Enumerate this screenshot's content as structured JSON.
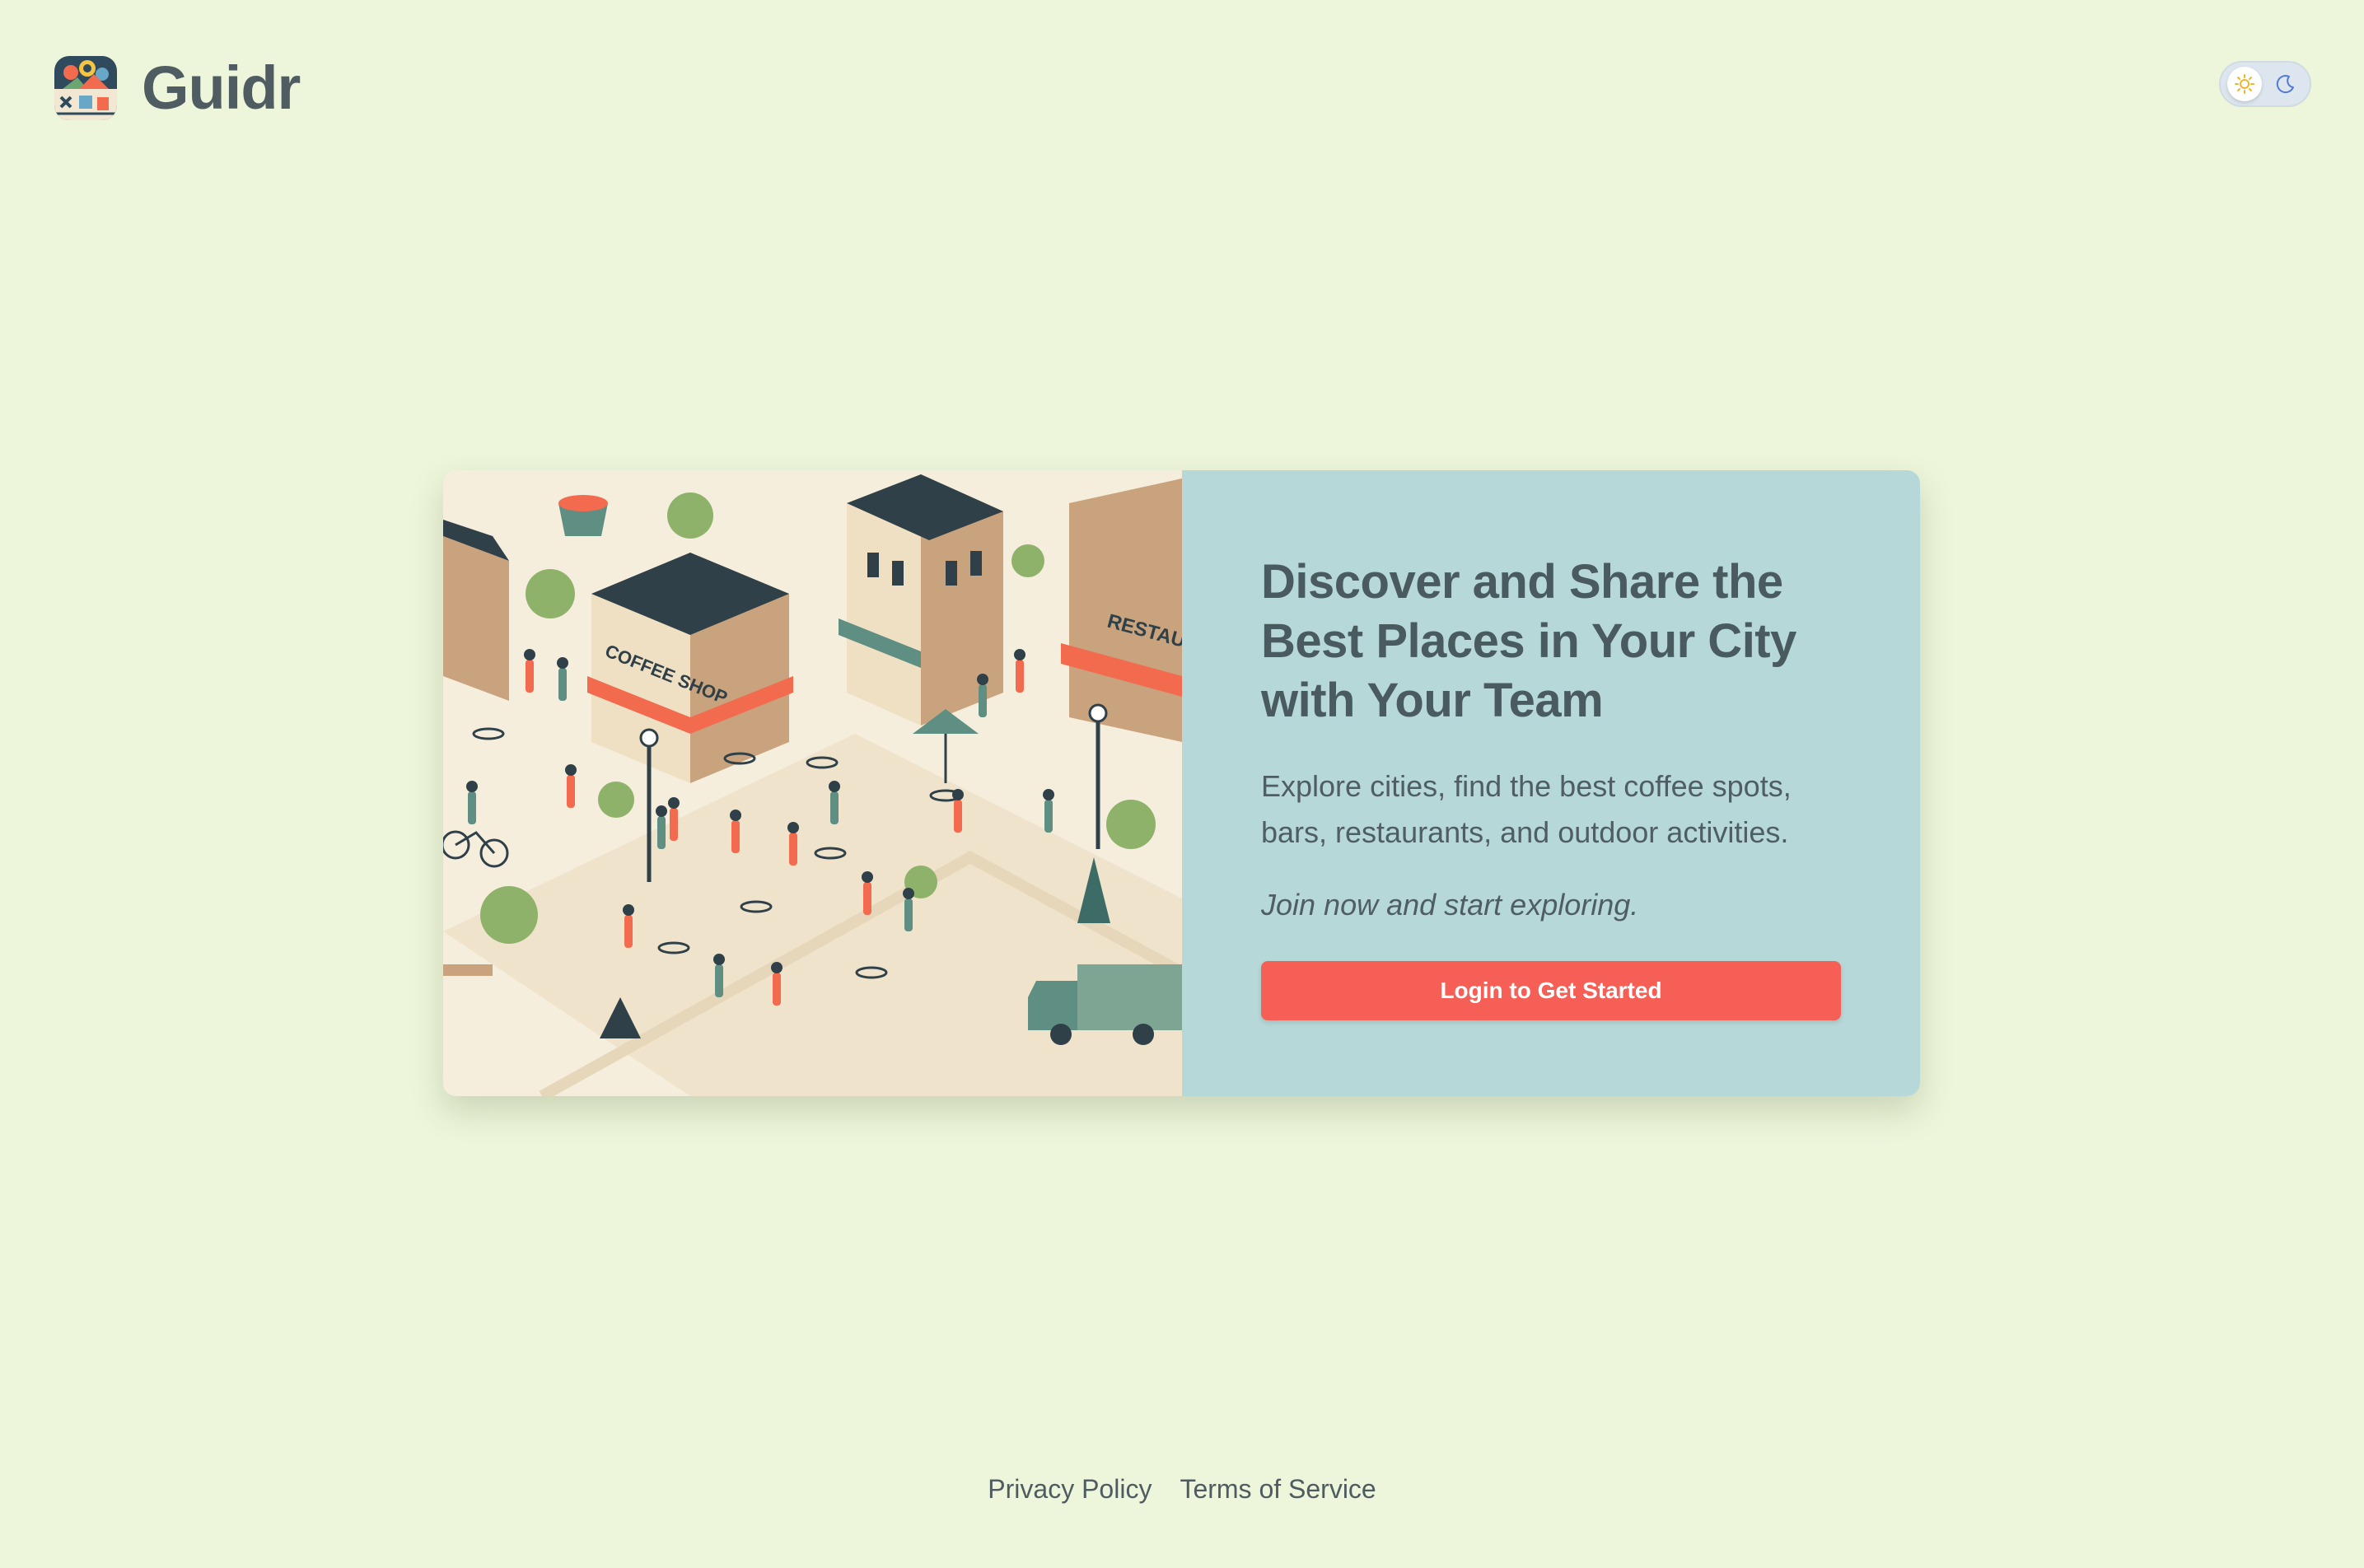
{
  "app": {
    "name": "Guidr"
  },
  "theme_toggle": {
    "light_icon": "sun-icon",
    "dark_icon": "moon-icon",
    "selected": "light"
  },
  "hero": {
    "illustration_icon": "city-street-illustration",
    "illustration_labels": {
      "coffee_shop": "COFFEE SHOP",
      "restaurant": "RESTAUR"
    },
    "title": "Discover and Share the Best Places in Your City with Your Team",
    "description": "Explore cities, find the best coffee spots, bars, restaurants, and outdoor activities.",
    "cta_text": "Join now and start exploring.",
    "login_button": "Login to Get Started"
  },
  "footer": {
    "links": [
      "Privacy Policy",
      "Terms of Service"
    ]
  },
  "colors": {
    "page_background": "#edf5da",
    "card_panel": "#b7d8d8",
    "button": "#f55f56",
    "text": "#4a5b60"
  }
}
